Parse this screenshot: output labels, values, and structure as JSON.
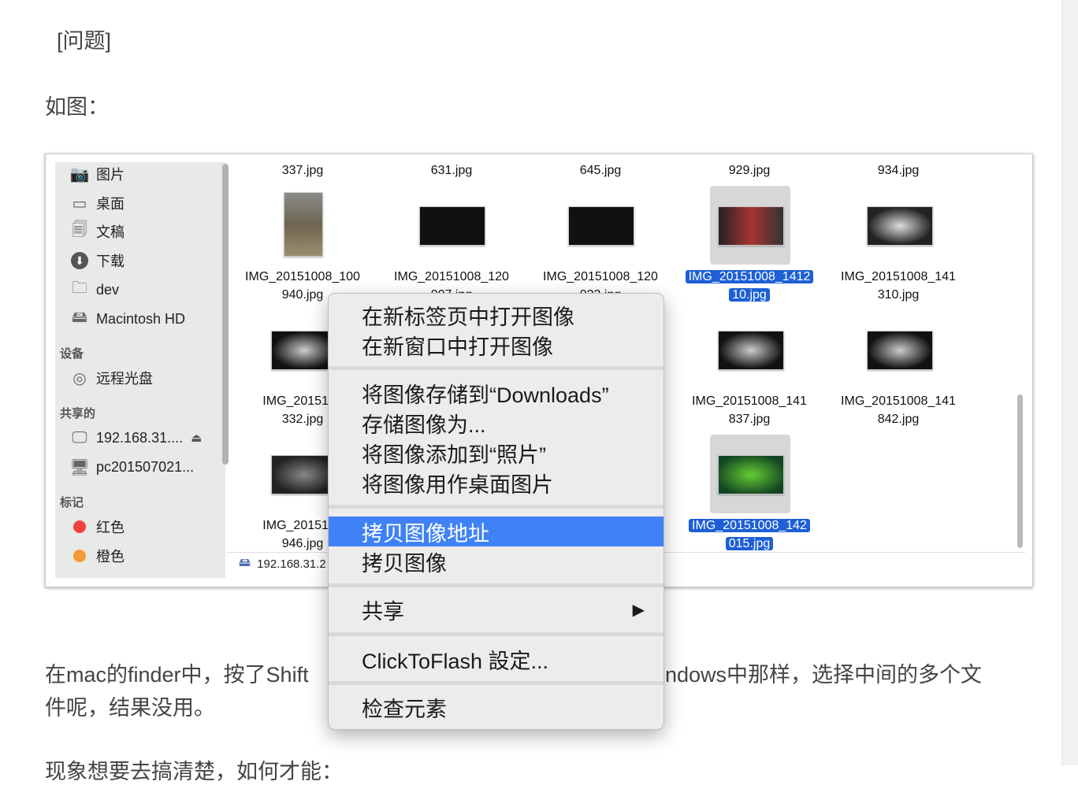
{
  "article": {
    "heading": "[问题]",
    "caption": "如图：",
    "para1_line1_left": "在mac的finder中，按了Shift",
    "para1_line1_right": "indows中那样，选择中间的多个文",
    "para1_line2": "件呢，结果没用。",
    "para2_partial": "现象想要去搞清楚，如何才能："
  },
  "finder": {
    "sidebar": {
      "favorites": [
        {
          "label": "图片",
          "icon": "camera-icon"
        },
        {
          "label": "桌面",
          "icon": "desktop-icon"
        },
        {
          "label": "文稿",
          "icon": "documents-icon"
        },
        {
          "label": "下载",
          "icon": "download-icon"
        },
        {
          "label": "dev",
          "icon": "folder-icon"
        },
        {
          "label": "Macintosh HD",
          "icon": "hard-drive-icon"
        }
      ],
      "devices_header": "设备",
      "devices": [
        {
          "label": "远程光盘",
          "icon": "disc-icon"
        }
      ],
      "shared_header": "共享的",
      "shared": [
        {
          "label": "192.168.31....",
          "icon": "monitor-icon",
          "eject": "⏏"
        },
        {
          "label": "pc201507021...",
          "icon": "pc-icon"
        }
      ],
      "tags_header": "标记",
      "tags": [
        {
          "label": "红色",
          "color": "#f2403f"
        },
        {
          "label": "橙色",
          "color": "#f59a35"
        }
      ]
    },
    "top_row": [
      "337.jpg",
      "631.jpg",
      "645.jpg",
      "929.jpg",
      "934.jpg"
    ],
    "files": [
      {
        "l1": "IMG_20151008_100",
        "l2": "940.jpg"
      },
      {
        "l1": "IMG_20151008_120",
        "l2": "007.jpg"
      },
      {
        "l1": "IMG_20151008_120",
        "l2": "022.jpg"
      },
      {
        "l1": "IMG_20151008_1412",
        "l2": "10.jpg",
        "selected": true
      },
      {
        "l1": "IMG_20151008_141",
        "l2": "310.jpg"
      },
      {
        "l1": "IMG_2015100",
        "l2": "332.jpg"
      },
      {
        "l1": "IMG_20151008_141",
        "l2": "837.jpg"
      },
      {
        "l1": "IMG_20151008_141",
        "l2": "842.jpg"
      },
      {
        "l1": "IMG_2015100",
        "l2": "946.jpg"
      },
      {
        "l1": "IMG_20151008_142",
        "l2": "015.jpg",
        "selected": true
      }
    ],
    "status_path": "192.168.31.2"
  },
  "context_menu": {
    "items": [
      "在新标签页中打开图像",
      "在新窗口中打开图像",
      "将图像存储到“Downloads”",
      "存储图像为...",
      "将图像添加到“照片”",
      "将图像用作桌面图片",
      "拷贝图像地址",
      "拷贝图像",
      "共享",
      "ClickToFlash 設定...",
      "检查元素"
    ],
    "highlighted": "拷贝图像地址",
    "submenu_arrow": "▶",
    "highlight_color": "#3f82f5"
  }
}
